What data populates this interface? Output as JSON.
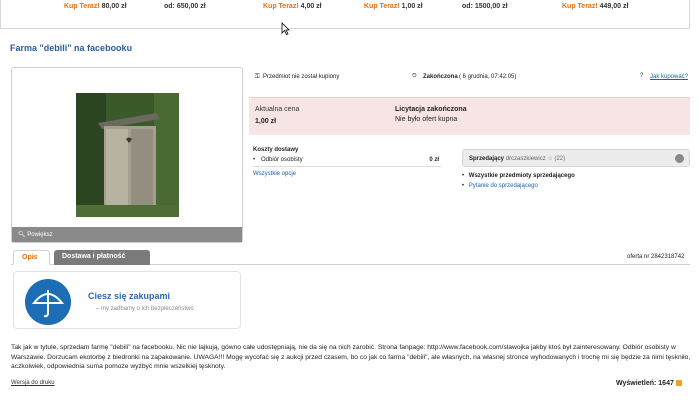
{
  "top_strip": {
    "cells": [
      {
        "label": "Kup Teraz!",
        "price": "80,00 zł"
      },
      {
        "label": "od:",
        "price": "650,00 zł"
      },
      {
        "label": "Kup Teraz!",
        "price": "4,00 zł"
      },
      {
        "label": "Kup Teraz!",
        "price": "1,00 zł"
      },
      {
        "label": "od:",
        "price": "1500,00 zł"
      },
      {
        "label": "Kup Teraz!",
        "price": "449,00 zł"
      }
    ]
  },
  "title": "Farma \"debili\" na facebooku",
  "image": {
    "enlarge_label": "Powiększ"
  },
  "status": {
    "not_bought": "Przedmiot nie został kupiony",
    "ended": "Zakończona",
    "ended_date": "( 6 grudnia, 07:42:05)",
    "how_to_buy": "Jak kupować?"
  },
  "price": {
    "current_label": "Aktualna cena",
    "current_value": "1,00 zł",
    "auction_ended": "Licytacja zakończona",
    "no_bids": "Nie było ofert kupna"
  },
  "shipping": {
    "title": "Koszty dostawy",
    "option": "Odbiór osobisty",
    "cost": "0 zł",
    "all_options": "Wszystkie opcje"
  },
  "seller": {
    "label": "Sprzedający",
    "name": "drczaszkiewicz",
    "rating": "(22)",
    "all_items": "Wszystkie przedmioty sprzedającego",
    "ask": "Pytanie do sprzedającego"
  },
  "tabs": {
    "description": "Opis",
    "delivery": "Dostawa i płatność"
  },
  "offer_number": "oferta nr 2842318742",
  "safe_shopping": {
    "heading": "Ciesz się zakupami",
    "sub": "– my zadbamy o ich bezpieczeństwo"
  },
  "description": "Tak jak w tytule, sprzedam farmę \"debili\" na facebooku. Nic nie lajkują, gówno całe udostępniają, nie da się na nich zarobić. Strona fanpage: http://www.facebook.com/slawojka jakby ktoś był zainteresowany. Odbiór osobisty w Warszawie. Dorzucam ekotorbę z biedronki na zapakowanie. UWAGA!!! Mogę wycofać się z aukcji przed czasem, bo co jak co farma \"debili\", ale własnych, na własnej stronce wyhodowanych i trochę mi się będzie za nimi tęskniło, aczkolwiek, odpowiednia suma pomoże wyzbyć mnie wszelkiej tęsknoty.",
  "footer": {
    "print_version": "Wersja do druku",
    "views_label": "Wyświetleń:",
    "views_count": "1647"
  },
  "colors": {
    "accent_orange": "#e8700b",
    "link_blue": "#1a5fb4",
    "price_bg": "#f7e4e4"
  }
}
